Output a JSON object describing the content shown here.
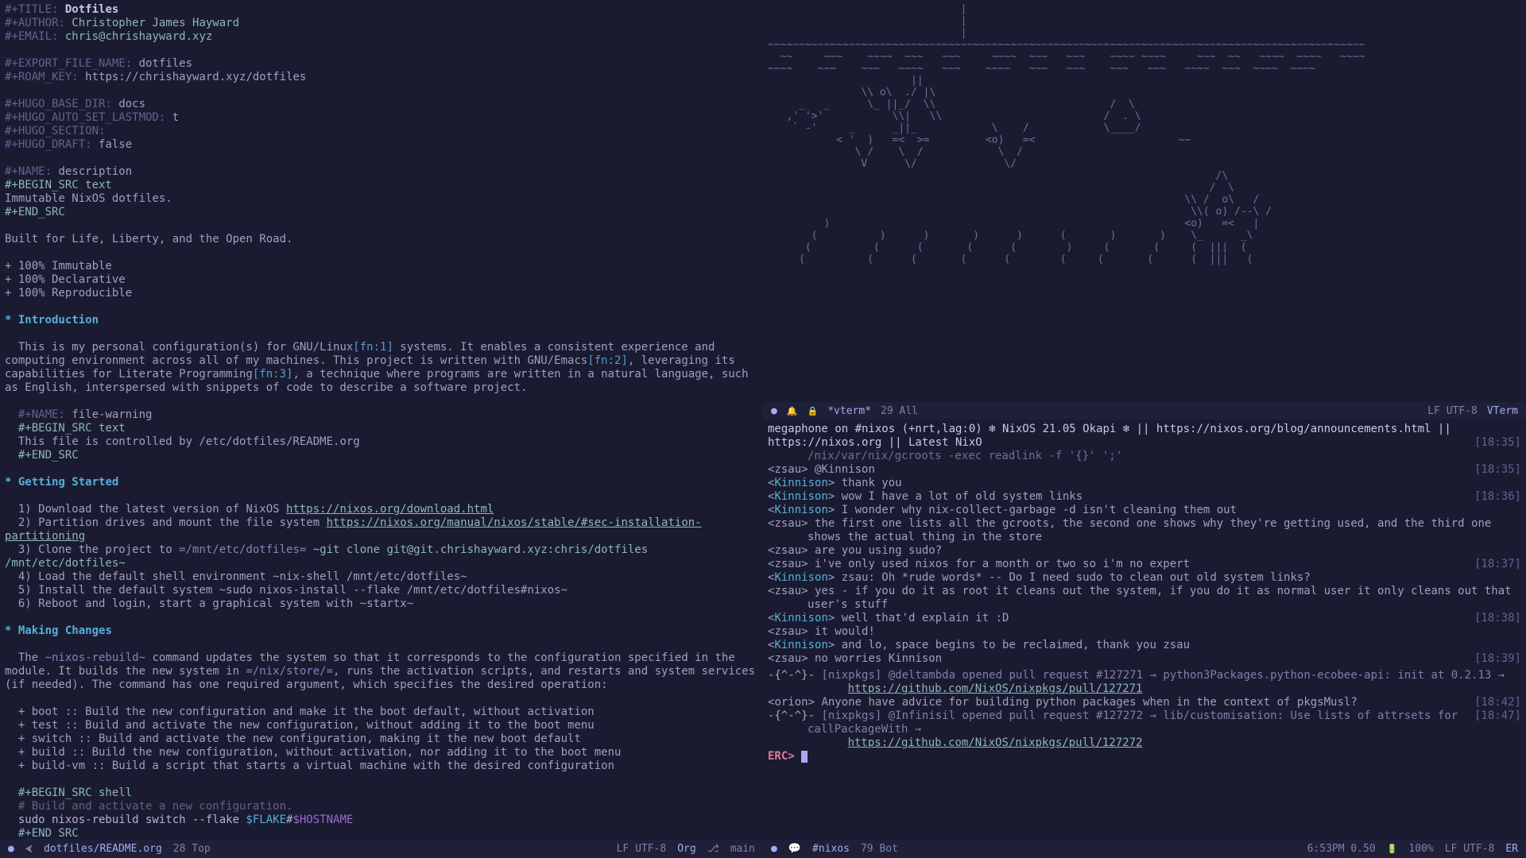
{
  "editor": {
    "meta": {
      "title_kw": "#+TITLE:",
      "title_val": "Dotfiles",
      "author_kw": "#+AUTHOR:",
      "author_val": "Christopher James Hayward",
      "email_kw": "#+EMAIL:",
      "email_val": "chris@chrishayward.xyz",
      "export_kw": "#+EXPORT_FILE_NAME:",
      "export_val": "dotfiles",
      "roam_kw": "#+ROAM_KEY:",
      "roam_val": "https://chrishayward.xyz/dotfiles",
      "hugo_base_kw": "#+HUGO_BASE_DIR:",
      "hugo_base_val": "docs",
      "hugo_lastmod_kw": "#+HUGO_AUTO_SET_LASTMOD:",
      "hugo_lastmod_val": "t",
      "hugo_section_kw": "#+HUGO_SECTION:",
      "hugo_draft_kw": "#+HUGO_DRAFT:",
      "hugo_draft_val": "false",
      "name_desc_kw": "#+NAME:",
      "name_desc_val": "description",
      "begin_src_text": "#+BEGIN_SRC text",
      "end_src": "#+END_SRC",
      "desc_body": "Immutable NixOS dotfiles.",
      "tagline": "Built for Life, Liberty, and the Open Road.",
      "bullets": [
        "+ 100% Immutable",
        "+ 100% Declarative",
        "+ 100% Reproducible"
      ]
    },
    "intro": {
      "heading": "Introduction",
      "body_a": "This is my personal configuration(s) for GNU/Linux",
      "fn1": "[fn:1]",
      "body_b": " systems. It enables a consistent experience and computing environment across all of my machines. This project is written with GNU/Emacs",
      "fn2": "[fn:2]",
      "body_c": ", leveraging its capabilities for Literate Programming",
      "fn3": "[fn:3]",
      "body_d": ", a technique where programs are written in a natural language, such as English, interspersed with snippets of code to describe a software project.",
      "name_warn_kw": "#+NAME:",
      "name_warn_val": "file-warning",
      "warn_body": "This file is controlled by /etc/dotfiles/README.org"
    },
    "getting_started": {
      "heading": "Getting Started",
      "l1a": "1) Download the latest version of NixOS ",
      "l1link": "https://nixos.org/download.html",
      "l2a": "2) Partition drives and mount the file system ",
      "l2link": "https://nixos.org/manual/nixos/stable/#sec-installation-partitioning",
      "l3a": "3) Clone the project to ",
      "l3code1": "=/mnt/etc/dotfiles=",
      "l3code2": " ~git clone git@git.chrishayward.xyz:chris/dotfiles /mnt/etc/dotfiles~",
      "l4": "4) Load the default shell environment ~nix-shell /mnt/etc/dotfiles~",
      "l5": "5) Install the default system ~sudo nixos-install --flake /mnt/etc/dotfiles#nixos~",
      "l6": "6) Reboot and login, start a graphical system with ~startx~"
    },
    "making_changes": {
      "heading": "Making Changes",
      "para_a": "The ",
      "para_code": "~nixos-rebuild~",
      "para_b": " command updates the system so that it corresponds to the configuration specified in the module. It builds the new system in ",
      "para_code2": "=/nix/store/=",
      "para_c": ", runs the activation scripts, and restarts and system services (if needed). The command has one required argument, which specifies the desired operation:",
      "ops": [
        "+ boot :: Build the new configuration and make it the boot default, without activation",
        "+ test :: Build and activate the new configuration, without adding it to the boot menu",
        "+ switch :: Build and activate the new configuration, making it the new boot default",
        "+ build :: Build the new configuration, without activation, nor adding it to the boot menu",
        "+ build-vm :: Build a script that starts a virtual machine with the desired configuration"
      ],
      "begin_src_shell": "#+BEGIN_SRC shell",
      "sh_comment": "# Build and activate a new configuration.",
      "sh_cmd_a": "sudo nixos-rebuild switch --flake ",
      "sh_var": "$FLAKE",
      "sh_hash": "#",
      "sh_host": "$HOSTNAME"
    },
    "modeline": {
      "buffer": "dotfiles/README.org",
      "pos": "28 Top",
      "enc": "LF UTF-8",
      "mode": "Org",
      "branch": "main"
    }
  },
  "vterm": {
    "modeline": {
      "buffer": "*vterm*",
      "pos": "29 All",
      "enc": "LF UTF-8",
      "mode": "VTerm"
    },
    "ascii": "                               |\n                               |\n                               |\n~~~~~~~~~~~~~~~~~~~~~~~~~~~~~~~~~~~~~~~~~~~~~~~~~~~~~~~~~~~~~~~~~~~~~~~~~~~~~~~~~~~~~~~~~~~~~~~~\n  ~~     ~~~    ~~~~  ~~~   ~~~     ~~~~  ~~~   ~~~    ~~~~ ~~~~     ~~~  ~~   ~~~~  ~~~~   ~~~~\n~~~~    ~~~    ~~~   ~~~~   ~~~    ~~~~   ~~~   ~~~    ~~~   ~~~   ~~~~  ~~~  ~~~~  ~~~~\n                       ||\n               \\\\ o\\  ./ |\\\n     _   _      \\_ ||_/  \\\\                            /  \\\n   ,' '>'           \\\\|   \\\\                          /  . \\\n    ` -'     _      _||_            \\    /            \\____/\n           < '  )   =<  >=         <o)   =<                       ~~\n              \\ /    \\  /            \\  /\n               V      \\/              \\/\n                                                                        /\\\n                                                                       /  \\\n                                                                   \\\\ /  o\\   /\n                                                                    \\\\( o) /--\\ /\n         )                                                         <o)   =<   |\n       (          )      )       )      )      (       )       )    \\_      _\\\n      (          (      (       (      (        )     (       (     (  |||  (\n     (          (      (       (      (        (     (       (      (  |||   (\n"
  },
  "erc": {
    "topic_a": "megaphone on #nixos (+nrt,lag:0) ",
    "topic_b": " NixOS 21.05 Okapi ",
    "topic_c": " || https://nixos.org/blog/announcements.html || https://nixos.org || Latest NixO",
    "topic_cmd": "/nix/var/nix/gcroots -exec readlink -f '{}' ';'",
    "messages": [
      {
        "ts": "[18:35]",
        "nick": "zsau",
        "cls": "erc-nick",
        "text": "@Kinnison"
      },
      {
        "ts": "",
        "nick": "Kinnison",
        "cls": "erc-nick2",
        "text": "thank you"
      },
      {
        "ts": "[18:36]",
        "nick": "Kinnison",
        "cls": "erc-nick2",
        "text": "wow I have a lot of old system links"
      },
      {
        "ts": "",
        "nick": "Kinnison",
        "cls": "erc-nick2",
        "text": "I wonder why nix-collect-garbage -d isn't cleaning them out"
      },
      {
        "ts": "",
        "nick": "zsau",
        "cls": "erc-nick",
        "text": "the first one lists all the gcroots, the second one shows why they're getting used, and the third one shows the actual thing in the store"
      },
      {
        "ts": "",
        "nick": "zsau",
        "cls": "erc-nick",
        "text": "are you using sudo?"
      },
      {
        "ts": "[18:37]",
        "nick": "zsau",
        "cls": "erc-nick",
        "text": "i've only used nixos for a month or two so i'm no expert"
      },
      {
        "ts": "",
        "nick": "Kinnison",
        "cls": "erc-nick2",
        "text": "zsau: Oh *rude words* -- Do I need sudo to clean out old system links?"
      },
      {
        "ts": "",
        "nick": "zsau",
        "cls": "erc-nick",
        "text": "yes - if you do it as root it cleans out the system, if you do it as normal user it only cleans out that user's stuff"
      },
      {
        "ts": "[18:38]",
        "nick": "Kinnison",
        "cls": "erc-nick2",
        "text": "well that'd explain it :D"
      },
      {
        "ts": "",
        "nick": "zsau",
        "cls": "erc-nick",
        "text": "it would!"
      },
      {
        "ts": "",
        "nick": "Kinnison",
        "cls": "erc-nick2",
        "text": "and lo, space begins to be reclaimed, thank you zsau"
      },
      {
        "ts": "[18:39]",
        "nick": "zsau",
        "cls": "erc-nick",
        "text": "no worries Kinnison"
      }
    ],
    "bot1": {
      "prefix": "-{^-^}-",
      "meta": "[nixpkgs] @delta​mbda opened pull request #127271 → python3Packages.python-ecobee-api: init at 0.2.13 →",
      "link": "https://github.com/NixOS/nixpkgs/pull/127271"
    },
    "orion": {
      "ts": "[18:42]",
      "nick": "orion",
      "text": "Anyone have advice for building python packages when in the context of pkgsMusl?"
    },
    "bot2": {
      "ts": "[18:47]",
      "prefix": "-{^-^}-",
      "meta": "[nixpkgs] @Infinisil opened pull request #127272 → lib/customisation: Use lists of attrsets for callPackageWith →",
      "link": "https://github.com/NixOS/nixpkgs/pull/127272"
    },
    "prompt": "ERC>",
    "modeline": {
      "buffer": "#nixos",
      "pos": "79 Bot",
      "time": "6:53PM 0.50",
      "bat": "100%",
      "enc": "LF UTF-8",
      "mode": "ER"
    }
  }
}
